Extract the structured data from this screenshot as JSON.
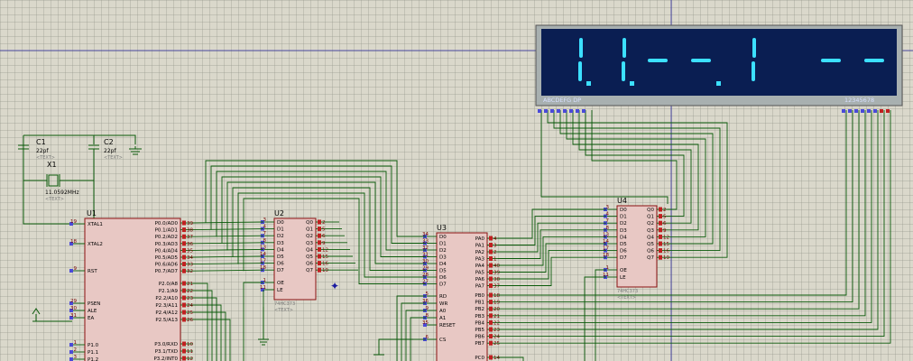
{
  "components": {
    "c1": {
      "ref": "C1",
      "value": "22pf",
      "text": "<TEXT>"
    },
    "c2": {
      "ref": "C2",
      "value": "22pf",
      "text": "<TEXT>"
    },
    "x1": {
      "ref": "X1",
      "value": "11.0592MHz",
      "text": "<TEXT>"
    },
    "u1": {
      "ref": "U1",
      "left_pins": [
        {
          "num": "19",
          "name": "XTAL1"
        },
        {
          "num": "18",
          "name": "XTAL2"
        },
        {
          "num": "9",
          "name": "RST"
        },
        {
          "num": "29",
          "name": "PSEN"
        },
        {
          "num": "30",
          "name": "ALE"
        },
        {
          "num": "31",
          "name": "EA"
        },
        {
          "num": "1",
          "name": "P1.0"
        },
        {
          "num": "2",
          "name": "P1.1"
        },
        {
          "num": "3",
          "name": "P1.2"
        }
      ],
      "right_pins": [
        {
          "num": "39",
          "name": "P0.0/AD0"
        },
        {
          "num": "38",
          "name": "P0.1/AD1"
        },
        {
          "num": "37",
          "name": "P0.2/AD2"
        },
        {
          "num": "36",
          "name": "P0.3/AD3"
        },
        {
          "num": "35",
          "name": "P0.4/AD4"
        },
        {
          "num": "34",
          "name": "P0.5/AD5"
        },
        {
          "num": "33",
          "name": "P0.6/AD6"
        },
        {
          "num": "32",
          "name": "P0.7/AD7"
        },
        {
          "num": "21",
          "name": "P2.0/A8"
        },
        {
          "num": "22",
          "name": "P2.1/A9"
        },
        {
          "num": "23",
          "name": "P2.2/A10"
        },
        {
          "num": "24",
          "name": "P2.3/A11"
        },
        {
          "num": "25",
          "name": "P2.4/A12"
        },
        {
          "num": "26",
          "name": "P2.5/A13"
        },
        {
          "num": "10",
          "name": "P3.0/RXD"
        },
        {
          "num": "11",
          "name": "P3.1/TXD"
        },
        {
          "num": "12",
          "name": "P3.2/INT0"
        }
      ]
    },
    "u2": {
      "ref": "U2",
      "part": "74HC373",
      "text": "<TEXT>",
      "left_pins": [
        {
          "num": "3",
          "name": "D0"
        },
        {
          "num": "4",
          "name": "D1"
        },
        {
          "num": "7",
          "name": "D2"
        },
        {
          "num": "8",
          "name": "D3"
        },
        {
          "num": "13",
          "name": "D4"
        },
        {
          "num": "14",
          "name": "D5"
        },
        {
          "num": "17",
          "name": "D6"
        },
        {
          "num": "18",
          "name": "D7"
        },
        {
          "num": "1",
          "name": "OE"
        },
        {
          "num": "11",
          "name": "LE"
        }
      ],
      "right_pins": [
        {
          "num": "2",
          "name": "Q0"
        },
        {
          "num": "5",
          "name": "Q1"
        },
        {
          "num": "6",
          "name": "Q2"
        },
        {
          "num": "9",
          "name": "Q3"
        },
        {
          "num": "12",
          "name": "Q4"
        },
        {
          "num": "15",
          "name": "Q5"
        },
        {
          "num": "16",
          "name": "Q6"
        },
        {
          "num": "19",
          "name": "Q7"
        }
      ]
    },
    "u3": {
      "ref": "U3",
      "left_pins": [
        {
          "num": "34",
          "name": "D0"
        },
        {
          "num": "33",
          "name": "D1"
        },
        {
          "num": "32",
          "name": "D2"
        },
        {
          "num": "31",
          "name": "D3"
        },
        {
          "num": "30",
          "name": "D4"
        },
        {
          "num": "29",
          "name": "D5"
        },
        {
          "num": "28",
          "name": "D6"
        },
        {
          "num": "27",
          "name": "D7"
        },
        {
          "num": "5",
          "name": "RD"
        },
        {
          "num": "36",
          "name": "WR"
        },
        {
          "num": "9",
          "name": "A0"
        },
        {
          "num": "8",
          "name": "A1"
        },
        {
          "num": "35",
          "name": "RESET"
        },
        {
          "num": "6",
          "name": "CS"
        }
      ],
      "right_pins": [
        {
          "num": "4",
          "name": "PA0"
        },
        {
          "num": "3",
          "name": "PA1"
        },
        {
          "num": "2",
          "name": "PA2"
        },
        {
          "num": "1",
          "name": "PA3"
        },
        {
          "num": "40",
          "name": "PA4"
        },
        {
          "num": "39",
          "name": "PA5"
        },
        {
          "num": "38",
          "name": "PA6"
        },
        {
          "num": "37",
          "name": "PA7"
        },
        {
          "num": "18",
          "name": "PB0"
        },
        {
          "num": "19",
          "name": "PB1"
        },
        {
          "num": "20",
          "name": "PB2"
        },
        {
          "num": "21",
          "name": "PB3"
        },
        {
          "num": "22",
          "name": "PB4"
        },
        {
          "num": "23",
          "name": "PB5"
        },
        {
          "num": "24",
          "name": "PB6"
        },
        {
          "num": "25",
          "name": "PB7"
        },
        {
          "num": "14",
          "name": "PC0"
        }
      ]
    },
    "u4": {
      "ref": "U4",
      "part": "74HC373",
      "text": "<TEXT>",
      "left_pins": [
        {
          "num": "3",
          "name": "D0"
        },
        {
          "num": "4",
          "name": "D1"
        },
        {
          "num": "7",
          "name": "D2"
        },
        {
          "num": "8",
          "name": "D3"
        },
        {
          "num": "13",
          "name": "D4"
        },
        {
          "num": "14",
          "name": "D5"
        },
        {
          "num": "17",
          "name": "D6"
        },
        {
          "num": "18",
          "name": "D7"
        },
        {
          "num": "1",
          "name": "OE"
        },
        {
          "num": "11",
          "name": "LE"
        }
      ],
      "right_pins": [
        {
          "num": "2",
          "name": "Q0"
        },
        {
          "num": "5",
          "name": "Q1"
        },
        {
          "num": "6",
          "name": "Q2"
        },
        {
          "num": "9",
          "name": "Q3"
        },
        {
          "num": "12",
          "name": "Q4"
        },
        {
          "num": "15",
          "name": "Q5"
        },
        {
          "num": "16",
          "name": "Q6"
        },
        {
          "num": "19",
          "name": "Q7"
        }
      ]
    }
  },
  "display": {
    "segment_label": "ABCDEFG DP",
    "digit_label": "12345678",
    "readout": [
      "1.",
      "1.",
      "-",
      "-.",
      "1",
      "",
      "-",
      "-"
    ],
    "segment_color": "#3ce0ff",
    "panel_color": "#0a1e52"
  },
  "colors": {
    "wire": "#0a5a0a",
    "chip_fill": "#e8c8c4",
    "chip_stroke": "#8a1010",
    "pin_pad": "#4a4ad8"
  }
}
